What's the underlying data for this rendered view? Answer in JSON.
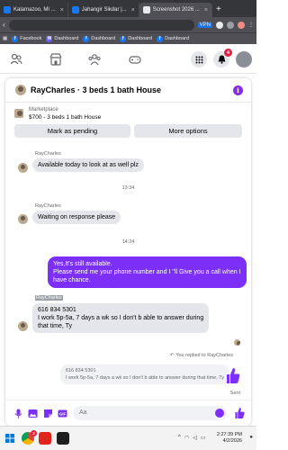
{
  "browser": {
    "tabs": [
      {
        "label": "Kalamazoo, MI ..."
      },
      {
        "label": "Jahangir Sikdar |..."
      },
      {
        "label": "Screenshot 2026 ..."
      }
    ],
    "vpn_label": "VPN",
    "bookmarks": [
      {
        "label": "Facebook"
      },
      {
        "label": "Dashboard"
      },
      {
        "label": "Dashboard"
      },
      {
        "label": "Dashboard"
      },
      {
        "label": "Dashboard"
      }
    ]
  },
  "fbnav": {
    "notifications_count": "4"
  },
  "chat": {
    "title": "RayCharles · 3 beds 1 bath House",
    "marketplace_label": "Marketplace",
    "listing": "$700 - 3 beds 1 bath House",
    "mark_pending": "Mark as pending",
    "more_options": "More options",
    "messages": [
      {
        "sender": "RayCharles",
        "text": "Available today to look at as well plz"
      },
      {
        "timestamp": "13:34"
      },
      {
        "sender": "RayCharles",
        "text": "Waiting on response please"
      },
      {
        "timestamp": "14:24"
      },
      {
        "outgoing_lines": [
          "Yes,It's still available.",
          "Please send me your phone number and I ''ll Give you a call when I",
          "have chance."
        ]
      },
      {
        "sender": "RayCharles",
        "lines": [
          "616 834 5301",
          "I work 5p-5a, 7 days a wk so I don't b able to answer during",
          "that time, Ty"
        ]
      }
    ],
    "reply_note": "You replied to RayCharles",
    "quoted_lines": [
      "616 834 5301",
      "I work 5p-5a, 7 days a wk so I don't b able to answer during that time, Ty"
    ],
    "sent_label": "Sent",
    "composer_placeholder": "Aa"
  },
  "taskbar": {
    "time": "2:27:39 PM",
    "date": "4/2/2026",
    "chrome_badge": "2"
  },
  "colors": {
    "accent": "#7b2ff7",
    "facebook_blue": "#1877f2",
    "bubble_in": "#e4e6eb"
  }
}
